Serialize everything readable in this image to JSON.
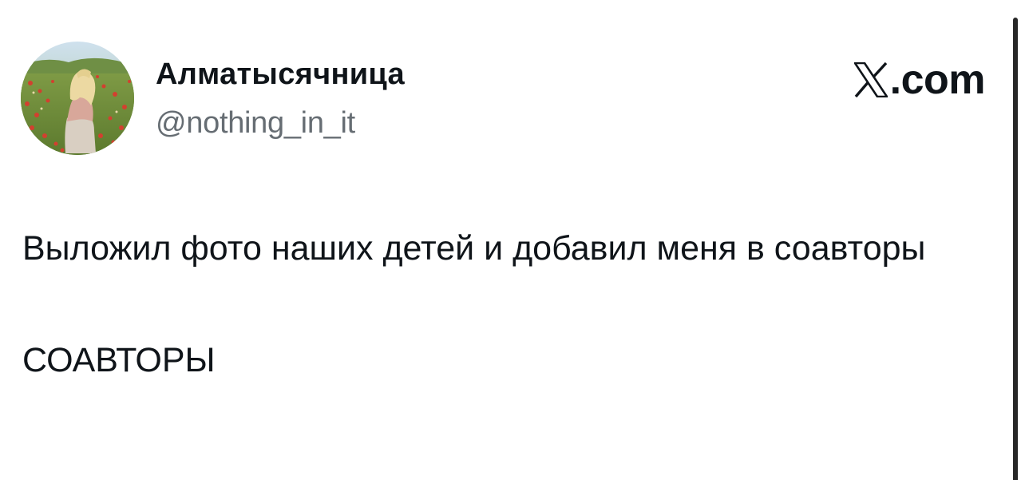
{
  "author": {
    "display_name": "Алматысячница",
    "handle": "@nothing_in_it",
    "avatar_icon": "avatar-photo-woman-in-poppy-field"
  },
  "brand": {
    "icon": "x-logo-icon",
    "suffix": ".com"
  },
  "tweet": {
    "line1": "Выложил фото наших детей и добавил меня в соавторы",
    "line2": "СОАВТОРЫ"
  },
  "colors": {
    "text": "#0f1419",
    "handle": "#666d73",
    "background": "#ffffff"
  }
}
